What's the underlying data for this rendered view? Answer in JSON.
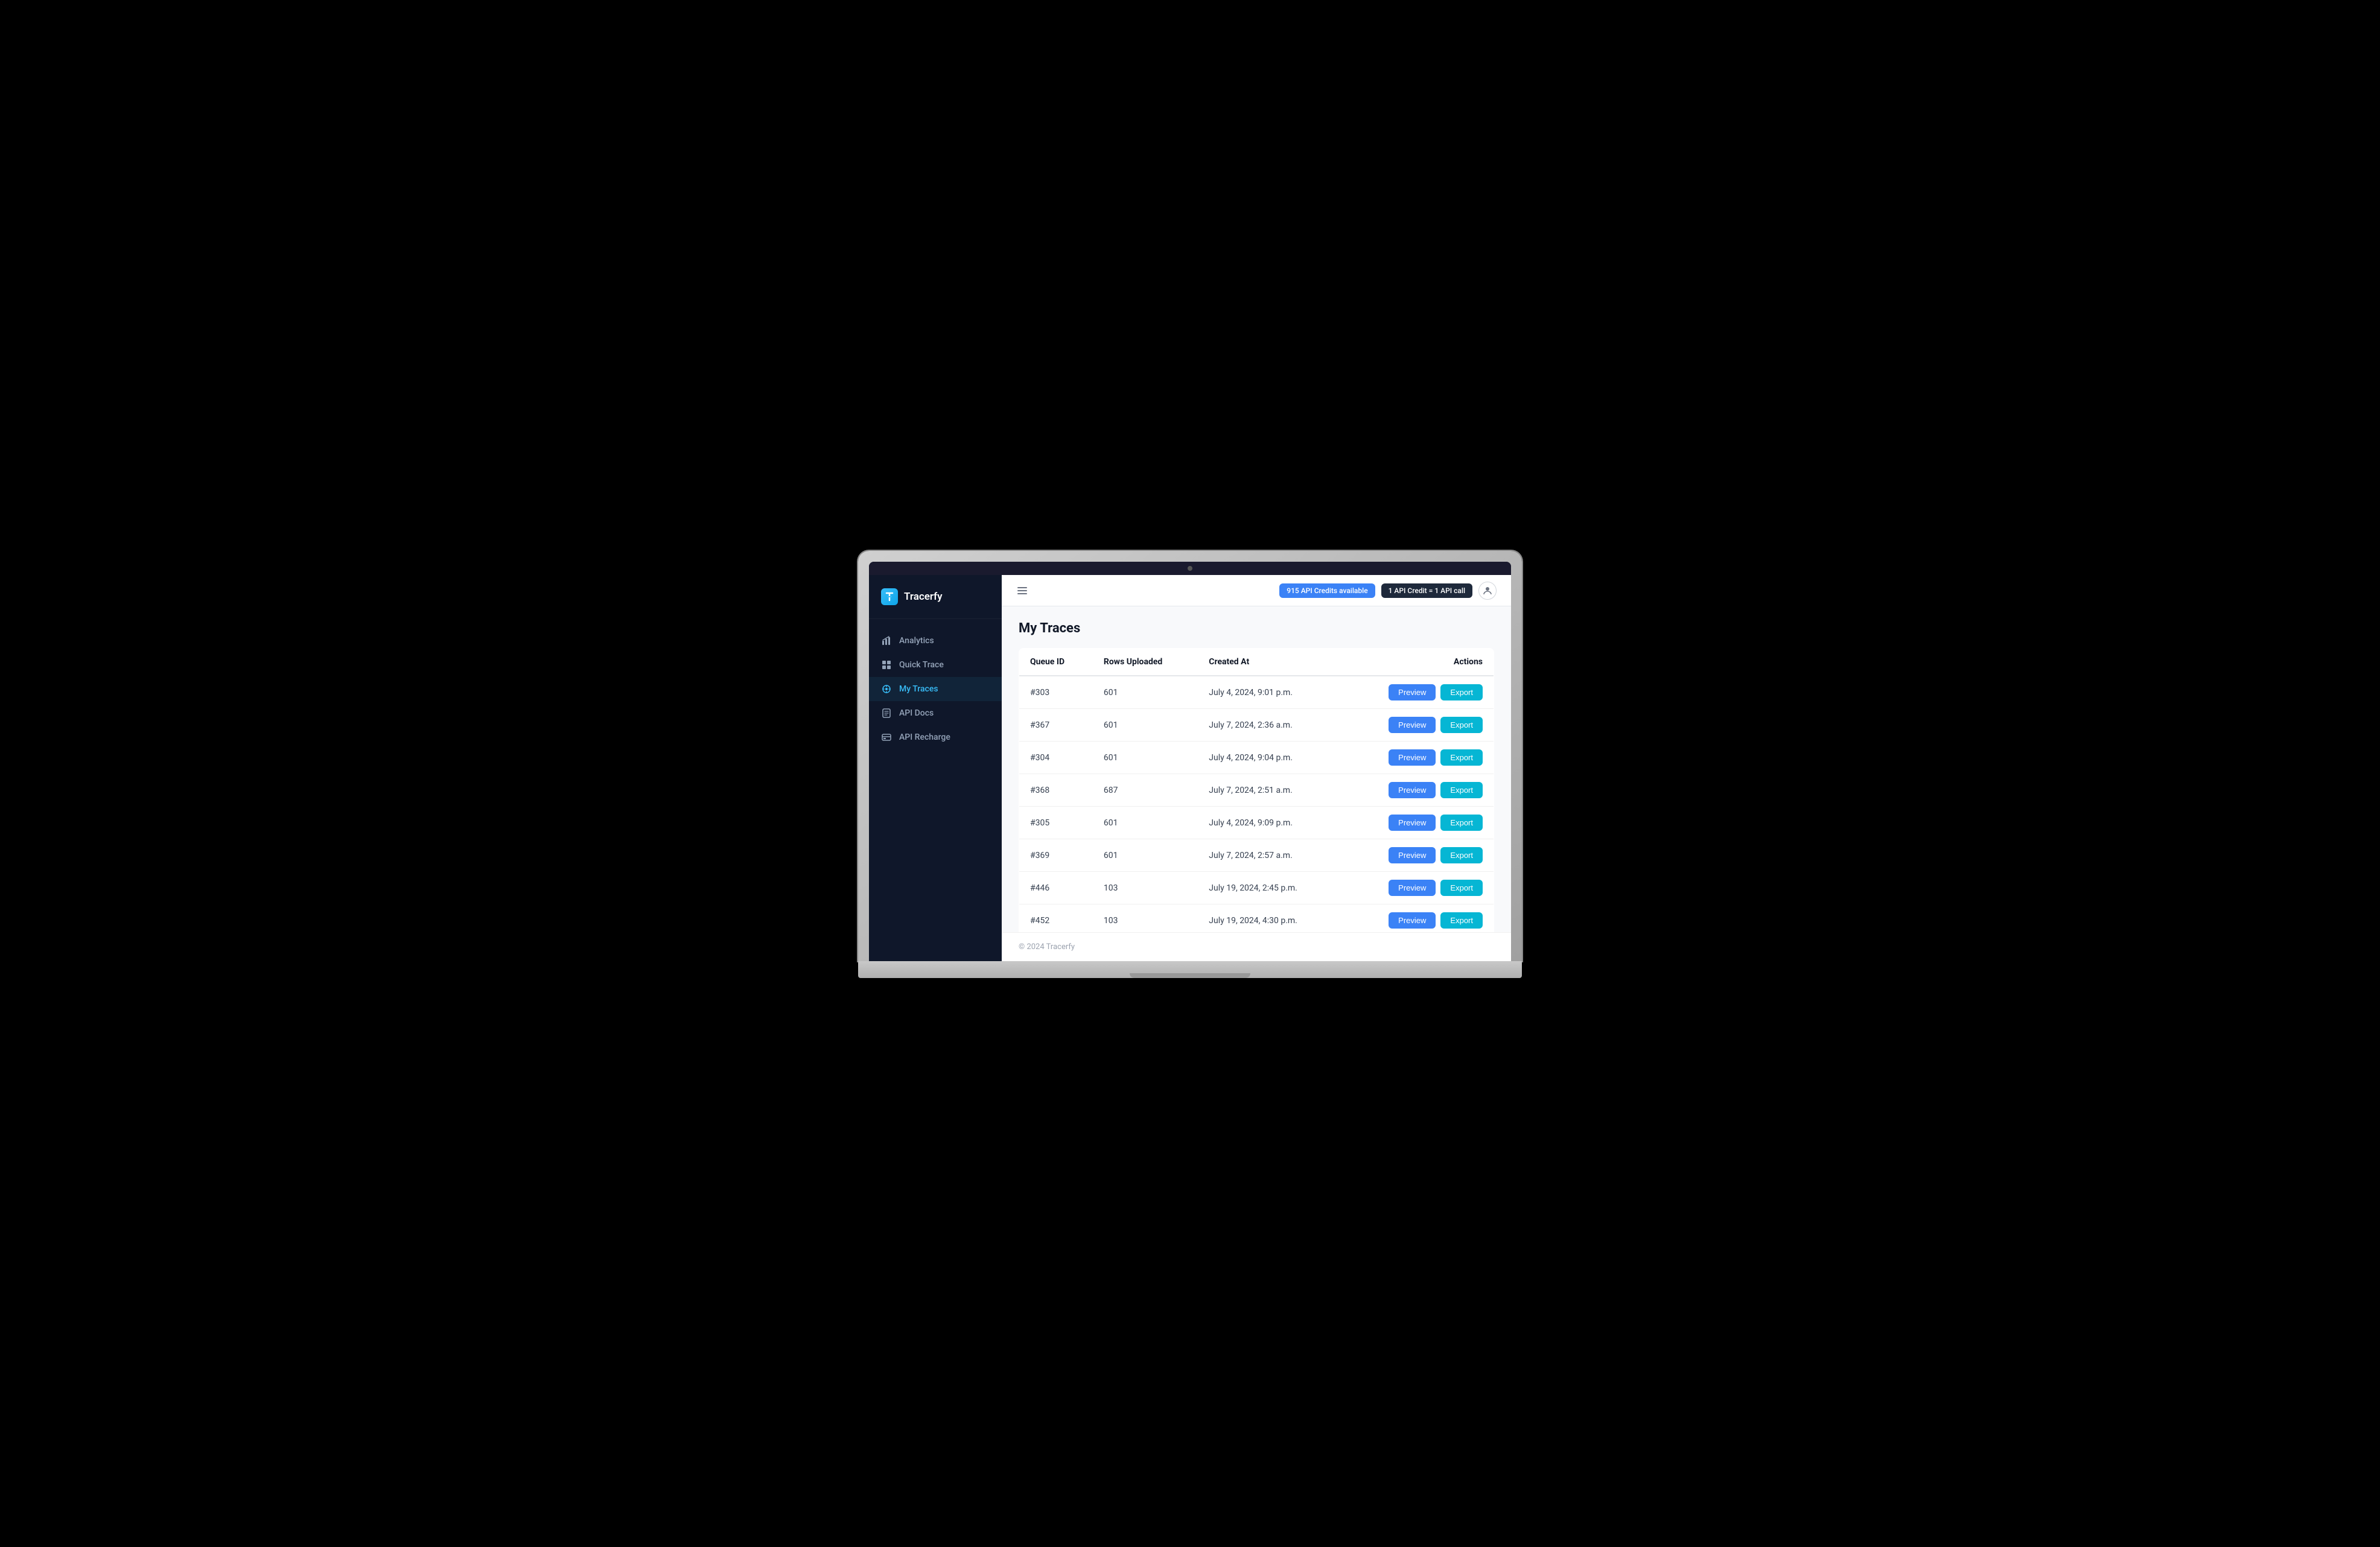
{
  "app": {
    "name": "Tracerfy",
    "logo_letter": "t"
  },
  "header": {
    "menu_icon": "≡",
    "credits_badge": "915 API Credits available",
    "credit_info_badge": "1 API Credit = 1 API call",
    "user_icon": "👤"
  },
  "sidebar": {
    "items": [
      {
        "id": "analytics",
        "label": "Analytics",
        "icon": "📊",
        "active": false
      },
      {
        "id": "quick-trace",
        "label": "Quick Trace",
        "icon": "⚡",
        "active": false
      },
      {
        "id": "my-traces",
        "label": "My Traces",
        "icon": "🌐",
        "active": true
      },
      {
        "id": "api-docs",
        "label": "API Docs",
        "icon": "📄",
        "active": false
      },
      {
        "id": "api-recharge",
        "label": "API Recharge",
        "icon": "💳",
        "active": false
      }
    ]
  },
  "page": {
    "title": "My Traces"
  },
  "table": {
    "columns": [
      "Queue ID",
      "Rows Uploaded",
      "Created At",
      "Actions"
    ],
    "rows": [
      {
        "queue_id": "#303",
        "rows_uploaded": "601",
        "created_at": "July 4, 2024, 9:01 p.m."
      },
      {
        "queue_id": "#367",
        "rows_uploaded": "601",
        "created_at": "July 7, 2024, 2:36 a.m."
      },
      {
        "queue_id": "#304",
        "rows_uploaded": "601",
        "created_at": "July 4, 2024, 9:04 p.m."
      },
      {
        "queue_id": "#368",
        "rows_uploaded": "687",
        "created_at": "July 7, 2024, 2:51 a.m."
      },
      {
        "queue_id": "#305",
        "rows_uploaded": "601",
        "created_at": "July 4, 2024, 9:09 p.m."
      },
      {
        "queue_id": "#369",
        "rows_uploaded": "601",
        "created_at": "July 7, 2024, 2:57 a.m."
      },
      {
        "queue_id": "#446",
        "rows_uploaded": "103",
        "created_at": "July 19, 2024, 2:45 p.m."
      },
      {
        "queue_id": "#452",
        "rows_uploaded": "103",
        "created_at": "July 19, 2024, 4:30 p.m."
      }
    ],
    "btn_preview": "Preview",
    "btn_export": "Export"
  },
  "footer": {
    "text": "© 2024 Tracerfy"
  }
}
